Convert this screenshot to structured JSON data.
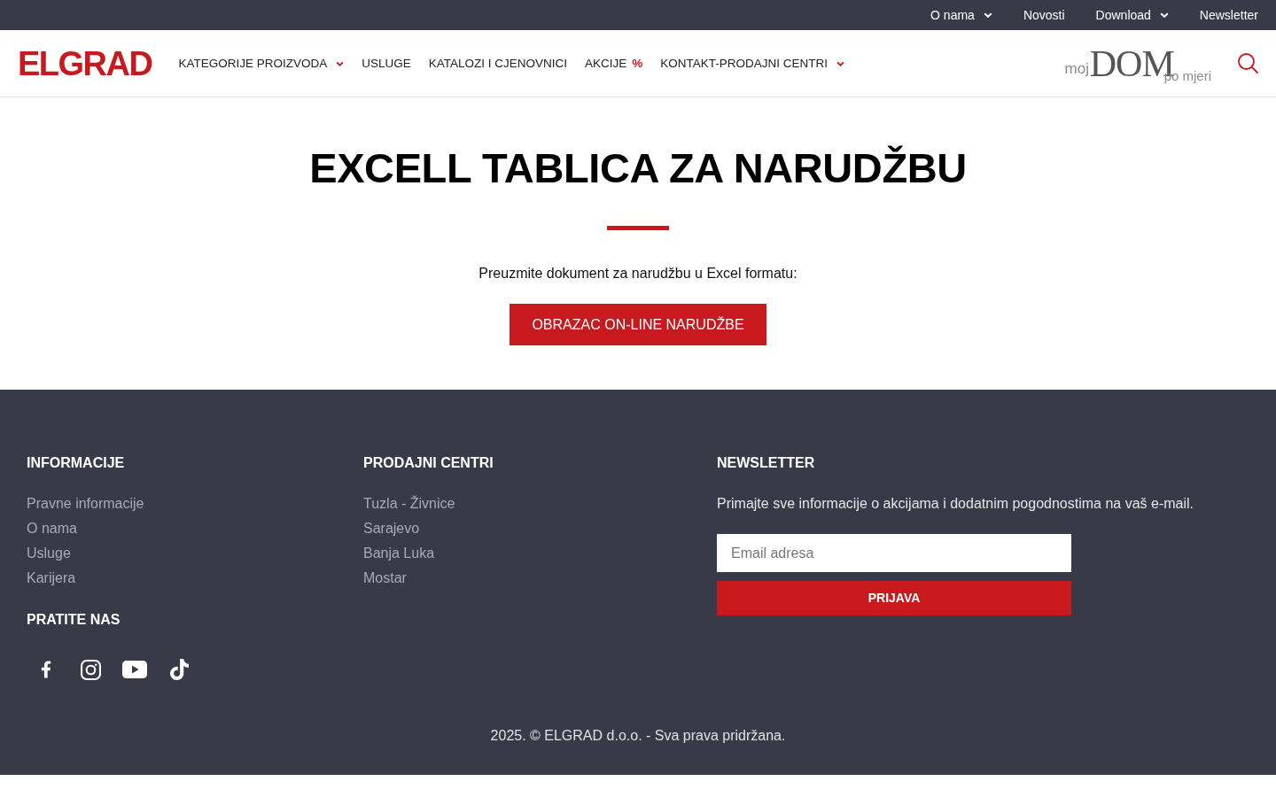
{
  "top_bar": {
    "links": [
      {
        "label": "O nama",
        "dropdown": true
      },
      {
        "label": "Novosti",
        "dropdown": false
      },
      {
        "label": "Download",
        "dropdown": true
      },
      {
        "label": "Newsletter",
        "dropdown": false
      }
    ]
  },
  "header": {
    "logo": "ELGRAD",
    "nav": [
      {
        "label": "KATEGORIJE PROIZVODA",
        "dropdown": true
      },
      {
        "label": "USLUGE",
        "dropdown": false
      },
      {
        "label": "KATALOZI I CJENOVNICI",
        "dropdown": false
      },
      {
        "label": "AKCIJE",
        "badge": "%",
        "dropdown": false
      },
      {
        "label": "KONTAKT-PRODAJNI CENTRI",
        "dropdown": true
      }
    ],
    "brand": {
      "prefix": "moj",
      "name": "DOM",
      "suffix": "po mjeri"
    }
  },
  "main": {
    "title": "EXCELL TABLICA ZA NARUDŽBU",
    "intro": "Preuzmite dokument za narudžbu u Excel formatu:",
    "button": "OBRAZAC ON-LINE NARUDŽBE"
  },
  "footer": {
    "columns": [
      {
        "heading": "INFORMACIJE",
        "links": [
          "Pravne informacije",
          "O nama",
          "Usluge",
          "Karijera"
        ]
      },
      {
        "heading": "PRODAJNI CENTRI",
        "links": [
          "Tuzla - Živnice",
          "Sarajevo",
          "Banja Luka",
          "Mostar"
        ]
      }
    ],
    "social": {
      "heading": "PRATITE NAS"
    },
    "newsletter": {
      "heading": "NEWSLETTER",
      "text": "Primajte sve informacije o akcijama i dodatnim pogodnostima na vaš e-mail.",
      "email": {
        "placeholder": "Email adresa"
      },
      "button": "PRIJAVA"
    },
    "copyright": "2025. © ELGRAD d.o.o. - Sva prava pridržana."
  }
}
